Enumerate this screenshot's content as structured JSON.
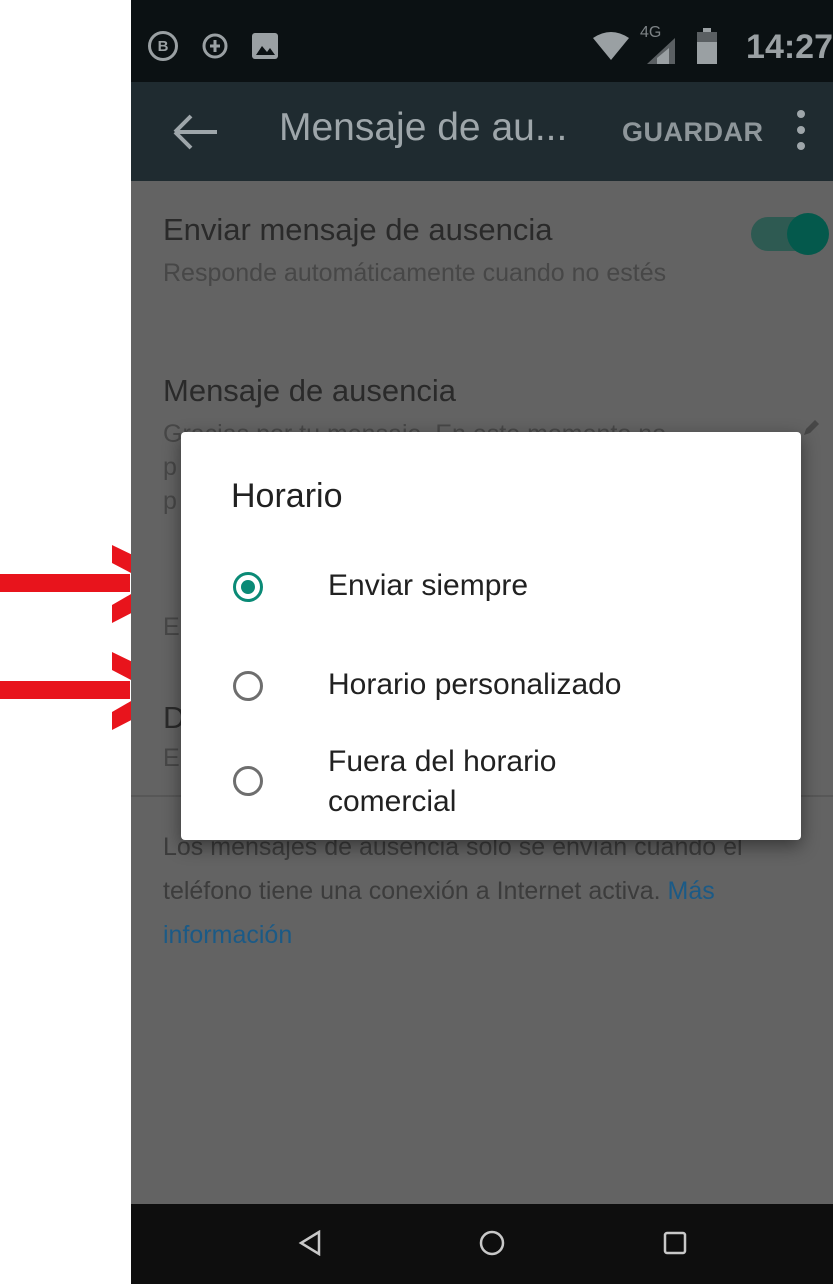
{
  "status_bar": {
    "icons": [
      "b-badge-icon",
      "data-saver-icon",
      "image-icon",
      "wifi-icon",
      "signal-icon",
      "battery-icon"
    ],
    "b_label": "B",
    "network": "4G",
    "time": "14:27"
  },
  "app_bar": {
    "title": "Mensaje de au...",
    "save_label": "GUARDAR"
  },
  "settings": {
    "auto_reply": {
      "title": "Enviar mensaje de ausencia",
      "subtitle": "Responde automáticamente cuando no estés",
      "enabled": true
    },
    "message": {
      "title": "Mensaje de ausencia",
      "subtitle_visible": "Gracias por tu mensaje. En este momento no"
    },
    "obscured_letters": [
      "p",
      "p",
      "E",
      "D",
      "E"
    ]
  },
  "footer": {
    "text": "Los mensajes de ausencia solo se envían cuando el teléfono tiene una conexión a Internet activa.",
    "link": "Más información"
  },
  "dialog": {
    "title": "Horario",
    "options": [
      {
        "label": "Enviar siempre",
        "selected": true
      },
      {
        "label": "Horario personalizado",
        "selected": false
      },
      {
        "label": "Fuera del horario comercial",
        "selected": false
      }
    ]
  },
  "colors": {
    "accent": "#0a8a76",
    "arrow": "#e8141c",
    "toolbar": "#1f2b30"
  }
}
